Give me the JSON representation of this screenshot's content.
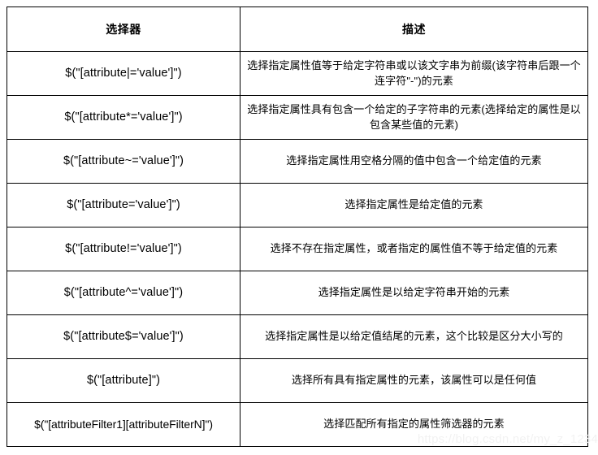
{
  "table": {
    "headers": {
      "selector": "选择器",
      "description": "描述"
    },
    "rows": [
      {
        "selector": "$(\"[attribute|='value']\")",
        "description": "选择指定属性值等于给定字符串或以该文字串为前缀(该字符串后跟一个连字符\"-\")的元素"
      },
      {
        "selector": "$(\"[attribute*='value']\")",
        "description": "选择指定属性具有包含一个给定的子字符串的元素(选择给定的属性是以包含某些值的元素)"
      },
      {
        "selector": "$(\"[attribute~='value']\")",
        "description": "选择指定属性用空格分隔的值中包含一个给定值的元素"
      },
      {
        "selector": "$(\"[attribute='value']\")",
        "description": "选择指定属性是给定值的元素"
      },
      {
        "selector": "$(\"[attribute!='value']\")",
        "description": "选择不存在指定属性，或者指定的属性值不等于给定值的元素"
      },
      {
        "selector": "$(\"[attribute^='value']\")",
        "description": "选择指定属性是以给定字符串开始的元素"
      },
      {
        "selector": "$(\"[attribute$='value']\")",
        "description": "选择指定属性是以给定值结尾的元素，这个比较是区分大小写的"
      },
      {
        "selector": "$(\"[attribute]\")",
        "description": "选择所有具有指定属性的元素，该属性可以是任何值"
      },
      {
        "selector": "$(\"[attributeFilter1][attributeFilterN]\")",
        "description": "选择匹配所有指定的属性筛选器的元素"
      }
    ]
  },
  "watermark": {
    "text": "https://blog.csdn.net/my_z_1234"
  },
  "colors": {
    "border": "#000000",
    "text": "#000000",
    "background": "#ffffff",
    "watermark": "#f2f2f2"
  }
}
